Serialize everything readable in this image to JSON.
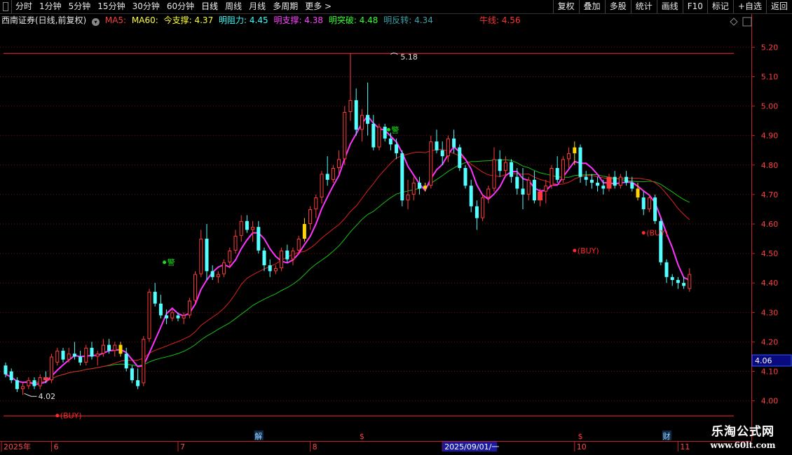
{
  "toolbar": {
    "left": [
      "分时",
      "1分钟",
      "5分钟",
      "15分钟",
      "30分钟",
      "60分钟",
      "日线",
      "周线",
      "月线",
      "多周期",
      "更多 >"
    ],
    "active": "日线",
    "right": [
      "复权",
      "叠加",
      "多股",
      "统计",
      "画线",
      "F10",
      "标记",
      "+自选",
      "返回"
    ]
  },
  "info": {
    "title": "西南证券(日线,前复权)",
    "ma5": "MA5:",
    "ma60": "MA60:",
    "support_today": "今支撑: 4.37",
    "resist_tomorrow": "明阻力: 4.45",
    "support_tomorrow": "明支撑: 4.38",
    "break_tomorrow": "明突破: 4.48",
    "reverse_tomorrow": "明反转: 4.34",
    "bull_line": "牛线: 4.56"
  },
  "colors": {
    "up": "#ff3b3b",
    "down": "#54ffff",
    "ma_main": "#ff33ff",
    "ma_mid": "#e02020",
    "ma_long": "#18c018",
    "buy": "#ff2a2a",
    "yellow": "#ffd400",
    "grid": "#7a1010",
    "axis": "#c8202a",
    "price_tag_bg": "#0a0a80"
  },
  "brand": {
    "name": "乐淘公式网",
    "url": "www.60lt.com"
  },
  "chart_data": {
    "type": "candlestick",
    "title": "西南证券(日线,前复权)",
    "y_ticks": [
      4.0,
      4.1,
      4.2,
      4.3,
      4.4,
      4.5,
      4.6,
      4.7,
      4.8,
      4.9,
      5.0,
      5.1,
      5.2
    ],
    "ylim": [
      3.935,
      5.265
    ],
    "x_labels": [
      {
        "label": "2025年",
        "index": 0
      },
      {
        "label": "6",
        "index": 8
      },
      {
        "label": "7",
        "index": 30
      },
      {
        "label": "8",
        "index": 53
      },
      {
        "label": "2025/09/01/一",
        "index": 76
      },
      {
        "label": "10",
        "index": 99
      },
      {
        "label": "11",
        "index": 117
      }
    ],
    "event_markers": [
      {
        "label": "解",
        "index": 44
      },
      {
        "label": "$",
        "index": 62
      },
      {
        "label": "$",
        "index": 100
      },
      {
        "label": "财",
        "index": 115
      }
    ],
    "annotations": {
      "high_label": "5.18",
      "high_index": 67,
      "low_label": "4.02",
      "low_index": 3,
      "current_price": "4.06",
      "resistance_line": 5.18,
      "support_line": 3.95,
      "buy_label": "(BUY)",
      "buy_points": [
        {
          "index": 9,
          "price": 3.95
        },
        {
          "index": 99,
          "price": 4.51
        },
        {
          "index": 111,
          "price": 4.57
        }
      ],
      "warning_label": "警",
      "warnings": [
        {
          "index": 28,
          "price": 4.47
        },
        {
          "index": 67,
          "price": 4.92
        }
      ]
    },
    "candles": [
      [
        4.12,
        4.13,
        4.08,
        4.09
      ],
      [
        4.1,
        4.11,
        4.06,
        4.07
      ],
      [
        4.07,
        4.08,
        4.03,
        4.04
      ],
      [
        4.04,
        4.06,
        4.02,
        4.05
      ],
      [
        4.05,
        4.08,
        4.04,
        4.07
      ],
      [
        4.07,
        4.08,
        4.04,
        4.05
      ],
      [
        4.05,
        4.09,
        4.04,
        4.08
      ],
      [
        4.08,
        4.1,
        4.06,
        4.07
      ],
      [
        4.07,
        4.16,
        4.06,
        4.15
      ],
      [
        4.13,
        4.18,
        4.12,
        4.17
      ],
      [
        4.17,
        4.18,
        4.13,
        4.14
      ],
      [
        4.14,
        4.18,
        4.13,
        4.16
      ],
      [
        4.16,
        4.2,
        4.14,
        4.15
      ],
      [
        4.15,
        4.17,
        4.12,
        4.13
      ],
      [
        4.13,
        4.19,
        4.12,
        4.18
      ],
      [
        4.18,
        4.2,
        4.14,
        4.15
      ],
      [
        4.15,
        4.17,
        4.12,
        4.16
      ],
      [
        4.16,
        4.21,
        4.15,
        4.19
      ],
      [
        4.19,
        4.21,
        4.16,
        4.17
      ],
      [
        4.17,
        4.2,
        4.15,
        4.19
      ],
      [
        4.19,
        4.2,
        4.15,
        4.16
      ],
      [
        4.16,
        4.18,
        4.1,
        4.11
      ],
      [
        4.11,
        4.12,
        4.06,
        4.07
      ],
      [
        4.07,
        4.11,
        4.04,
        4.05
      ],
      [
        4.06,
        4.22,
        4.05,
        4.21
      ],
      [
        4.21,
        4.38,
        4.2,
        4.37
      ],
      [
        4.37,
        4.4,
        4.32,
        4.33
      ],
      [
        4.33,
        4.36,
        4.28,
        4.29
      ],
      [
        4.29,
        4.31,
        4.26,
        4.28
      ],
      [
        4.28,
        4.31,
        4.27,
        4.3
      ],
      [
        4.29,
        4.3,
        4.27,
        4.28
      ],
      [
        4.28,
        4.3,
        4.26,
        4.29
      ],
      [
        4.29,
        4.35,
        4.28,
        4.34
      ],
      [
        4.34,
        4.44,
        4.33,
        4.43
      ],
      [
        4.43,
        4.58,
        4.42,
        4.55
      ],
      [
        4.55,
        4.6,
        4.41,
        4.44
      ],
      [
        4.44,
        4.46,
        4.41,
        4.42
      ],
      [
        4.42,
        4.44,
        4.4,
        4.43
      ],
      [
        4.43,
        4.48,
        4.42,
        4.47
      ],
      [
        4.47,
        4.52,
        4.45,
        4.51
      ],
      [
        4.51,
        4.58,
        4.5,
        4.56
      ],
      [
        4.56,
        4.63,
        4.54,
        4.61
      ],
      [
        4.61,
        4.63,
        4.57,
        4.58
      ],
      [
        4.58,
        4.61,
        4.54,
        4.59
      ],
      [
        4.59,
        4.61,
        4.5,
        4.51
      ],
      [
        4.51,
        4.52,
        4.44,
        4.46
      ],
      [
        4.46,
        4.48,
        4.42,
        4.44
      ],
      [
        4.44,
        4.46,
        4.43,
        4.45
      ],
      [
        4.45,
        4.52,
        4.44,
        4.51
      ],
      [
        4.51,
        4.53,
        4.47,
        4.48
      ],
      [
        4.48,
        4.52,
        4.46,
        4.51
      ],
      [
        4.51,
        4.56,
        4.5,
        4.55
      ],
      [
        4.55,
        4.62,
        4.54,
        4.6
      ],
      [
        4.6,
        4.66,
        4.58,
        4.65
      ],
      [
        4.65,
        4.7,
        4.62,
        4.69
      ],
      [
        4.69,
        4.78,
        4.67,
        4.77
      ],
      [
        4.77,
        4.83,
        4.73,
        4.75
      ],
      [
        4.75,
        4.8,
        4.74,
        4.79
      ],
      [
        4.79,
        4.85,
        4.77,
        4.82
      ],
      [
        4.82,
        5.0,
        4.8,
        4.98
      ],
      [
        4.98,
        5.18,
        4.95,
        5.02
      ],
      [
        5.02,
        5.06,
        4.9,
        4.92
      ],
      [
        4.92,
        4.99,
        4.88,
        4.97
      ],
      [
        4.97,
        5.08,
        4.9,
        4.94
      ],
      [
        4.94,
        4.97,
        4.85,
        4.86
      ],
      [
        4.86,
        4.94,
        4.85,
        4.93
      ],
      [
        4.93,
        4.94,
        4.88,
        4.89
      ],
      [
        4.89,
        4.91,
        4.85,
        4.87
      ],
      [
        4.87,
        4.89,
        4.82,
        4.84
      ],
      [
        4.84,
        4.85,
        4.66,
        4.68
      ],
      [
        4.68,
        4.75,
        4.65,
        4.7
      ],
      [
        4.7,
        4.76,
        4.68,
        4.74
      ],
      [
        4.74,
        4.76,
        4.7,
        4.72
      ],
      [
        4.72,
        4.74,
        4.71,
        4.73
      ],
      [
        4.73,
        4.9,
        4.72,
        4.88
      ],
      [
        4.88,
        4.92,
        4.84,
        4.85
      ],
      [
        4.85,
        4.88,
        4.8,
        4.83
      ],
      [
        4.83,
        4.9,
        4.81,
        4.89
      ],
      [
        4.89,
        4.92,
        4.84,
        4.86
      ],
      [
        4.86,
        4.87,
        4.78,
        4.79
      ],
      [
        4.79,
        4.8,
        4.72,
        4.73
      ],
      [
        4.73,
        4.75,
        4.64,
        4.66
      ],
      [
        4.66,
        4.68,
        4.58,
        4.62
      ],
      [
        4.62,
        4.7,
        4.61,
        4.69
      ],
      [
        4.69,
        4.73,
        4.67,
        4.72
      ],
      [
        4.72,
        4.86,
        4.71,
        4.82
      ],
      [
        4.82,
        4.85,
        4.76,
        4.78
      ],
      [
        4.78,
        4.83,
        4.76,
        4.81
      ],
      [
        4.81,
        4.82,
        4.74,
        4.76
      ],
      [
        4.76,
        4.79,
        4.7,
        4.72
      ],
      [
        4.72,
        4.79,
        4.65,
        4.7
      ],
      [
        4.7,
        4.76,
        4.68,
        4.75
      ],
      [
        4.75,
        4.78,
        4.67,
        4.68
      ],
      [
        4.68,
        4.72,
        4.66,
        4.71
      ],
      [
        4.71,
        4.75,
        4.67,
        4.73
      ],
      [
        4.73,
        4.8,
        4.72,
        4.79
      ],
      [
        4.79,
        4.83,
        4.74,
        4.75
      ],
      [
        4.75,
        4.83,
        4.74,
        4.82
      ],
      [
        4.82,
        4.86,
        4.79,
        4.84
      ],
      [
        4.84,
        4.88,
        4.8,
        4.86
      ],
      [
        4.86,
        4.87,
        4.74,
        4.76
      ],
      [
        4.76,
        4.78,
        4.73,
        4.75
      ],
      [
        4.75,
        4.77,
        4.72,
        4.74
      ],
      [
        4.74,
        4.76,
        4.71,
        4.73
      ],
      [
        4.73,
        4.75,
        4.7,
        4.72
      ],
      [
        4.72,
        4.77,
        4.71,
        4.76
      ],
      [
        4.76,
        4.78,
        4.72,
        4.73
      ],
      [
        4.73,
        4.77,
        4.72,
        4.76
      ],
      [
        4.76,
        4.78,
        4.73,
        4.74
      ],
      [
        4.74,
        4.76,
        4.71,
        4.72
      ],
      [
        4.72,
        4.74,
        4.68,
        4.69
      ],
      [
        4.69,
        4.71,
        4.63,
        4.65
      ],
      [
        4.65,
        4.7,
        4.64,
        4.69
      ],
      [
        4.69,
        4.7,
        4.6,
        4.61
      ],
      [
        4.61,
        4.62,
        4.46,
        4.47
      ],
      [
        4.47,
        4.48,
        4.4,
        4.42
      ],
      [
        4.42,
        4.43,
        4.39,
        4.41
      ],
      [
        4.41,
        4.42,
        4.38,
        4.4
      ],
      [
        4.4,
        4.42,
        4.38,
        4.39
      ],
      [
        4.38,
        4.45,
        4.37,
        4.43
      ]
    ],
    "special_candles": [
      {
        "index": 7,
        "style": "red_box"
      },
      {
        "index": 20,
        "style": "yellow"
      },
      {
        "index": 52,
        "style": "yellow"
      },
      {
        "index": 73,
        "style": "yellow"
      },
      {
        "index": 93,
        "style": "red_box"
      },
      {
        "index": 99,
        "style": "yellow"
      },
      {
        "index": 105,
        "style": "red_box"
      },
      {
        "index": 110,
        "style": "yellow"
      },
      {
        "index": 122,
        "style": "yellow"
      }
    ]
  }
}
